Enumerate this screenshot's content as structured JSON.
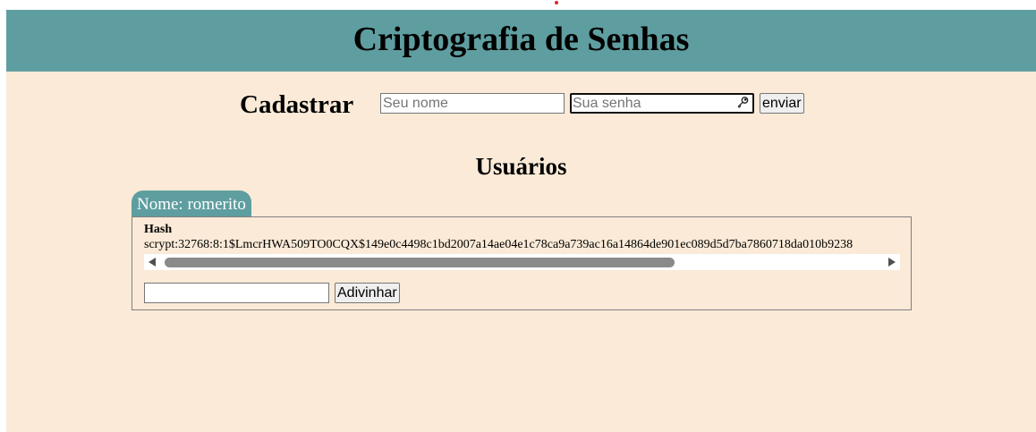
{
  "header": {
    "title": "Criptografia de Senhas"
  },
  "register": {
    "title": "Cadastrar",
    "name_placeholder": "Seu nome",
    "password_placeholder": "Sua senha",
    "submit_label": "enviar"
  },
  "users": {
    "title": "Usuários",
    "list": [
      {
        "tab_label": "Nome: romerito",
        "hash_label": "Hash",
        "hash_value": "scrypt:32768:8:1$LmcrHWA509TO0CQX$149e0c4498c1bd2007a14ae04e1c78ca9a739ac16a14864de901ec089d5d7ba7860718da010b9238",
        "guess_value": "",
        "guess_button_label": "Adivinhar"
      }
    ]
  },
  "icons": {
    "password_manager": "key-icon",
    "scroll_left": "arrow-left-icon",
    "scroll_right": "arrow-right-icon"
  },
  "colors": {
    "header_bg": "#5f9ea0",
    "page_bg": "#faead7",
    "tab_bg": "#5f9ea0"
  }
}
